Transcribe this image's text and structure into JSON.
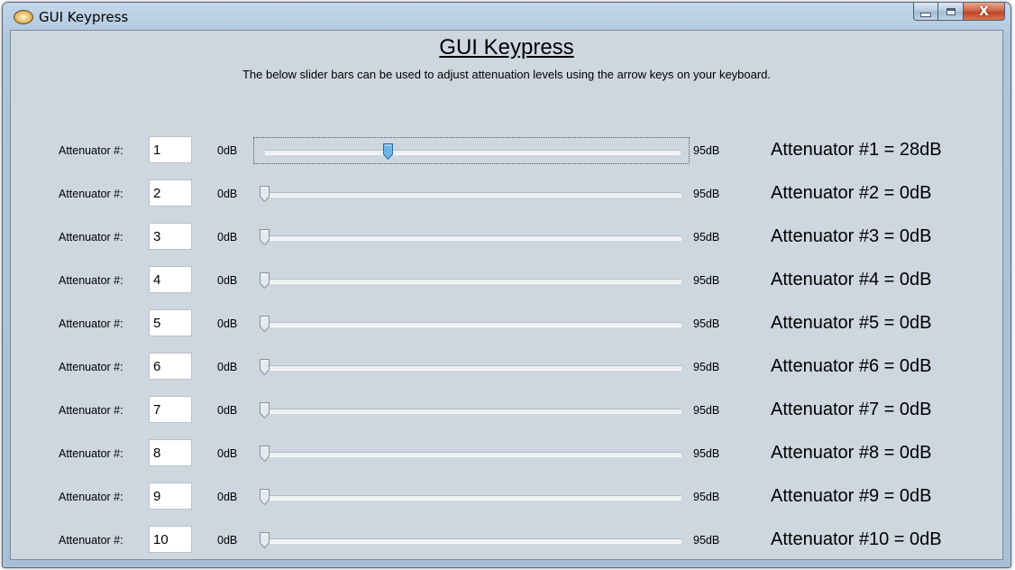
{
  "window": {
    "title": "GUI Keypress",
    "close_glyph": "X"
  },
  "heading": "GUI Keypress",
  "subtitle": "The below slider bars can be used to adjust attenuation levels using the arrow keys on your keyboard.",
  "slider_range": {
    "min_label": "0dB",
    "max_label": "95dB",
    "min": 0,
    "max": 95
  },
  "rows": [
    {
      "label": "Attenuator #:",
      "number": "1",
      "value_db": 28,
      "readout": "Attenuator #1 = 28dB",
      "focused": true
    },
    {
      "label": "Attenuator #:",
      "number": "2",
      "value_db": 0,
      "readout": "Attenuator #2 = 0dB",
      "focused": false
    },
    {
      "label": "Attenuator #:",
      "number": "3",
      "value_db": 0,
      "readout": "Attenuator #3 = 0dB",
      "focused": false
    },
    {
      "label": "Attenuator #:",
      "number": "4",
      "value_db": 0,
      "readout": "Attenuator #4 = 0dB",
      "focused": false
    },
    {
      "label": "Attenuator #:",
      "number": "5",
      "value_db": 0,
      "readout": "Attenuator #5 = 0dB",
      "focused": false
    },
    {
      "label": "Attenuator #:",
      "number": "6",
      "value_db": 0,
      "readout": "Attenuator #6 = 0dB",
      "focused": false
    },
    {
      "label": "Attenuator #:",
      "number": "7",
      "value_db": 0,
      "readout": "Attenuator #7 = 0dB",
      "focused": false
    },
    {
      "label": "Attenuator #:",
      "number": "8",
      "value_db": 0,
      "readout": "Attenuator #8 = 0dB",
      "focused": false
    },
    {
      "label": "Attenuator #:",
      "number": "9",
      "value_db": 0,
      "readout": "Attenuator #9 = 0dB",
      "focused": false
    },
    {
      "label": "Attenuator #:",
      "number": "10",
      "value_db": 0,
      "readout": "Attenuator #10 = 0dB",
      "focused": false
    }
  ],
  "colors": {
    "thumb_active": "#6fb6e6",
    "thumb_idle": "#e6eaee",
    "client_bg": "#ced6df"
  }
}
